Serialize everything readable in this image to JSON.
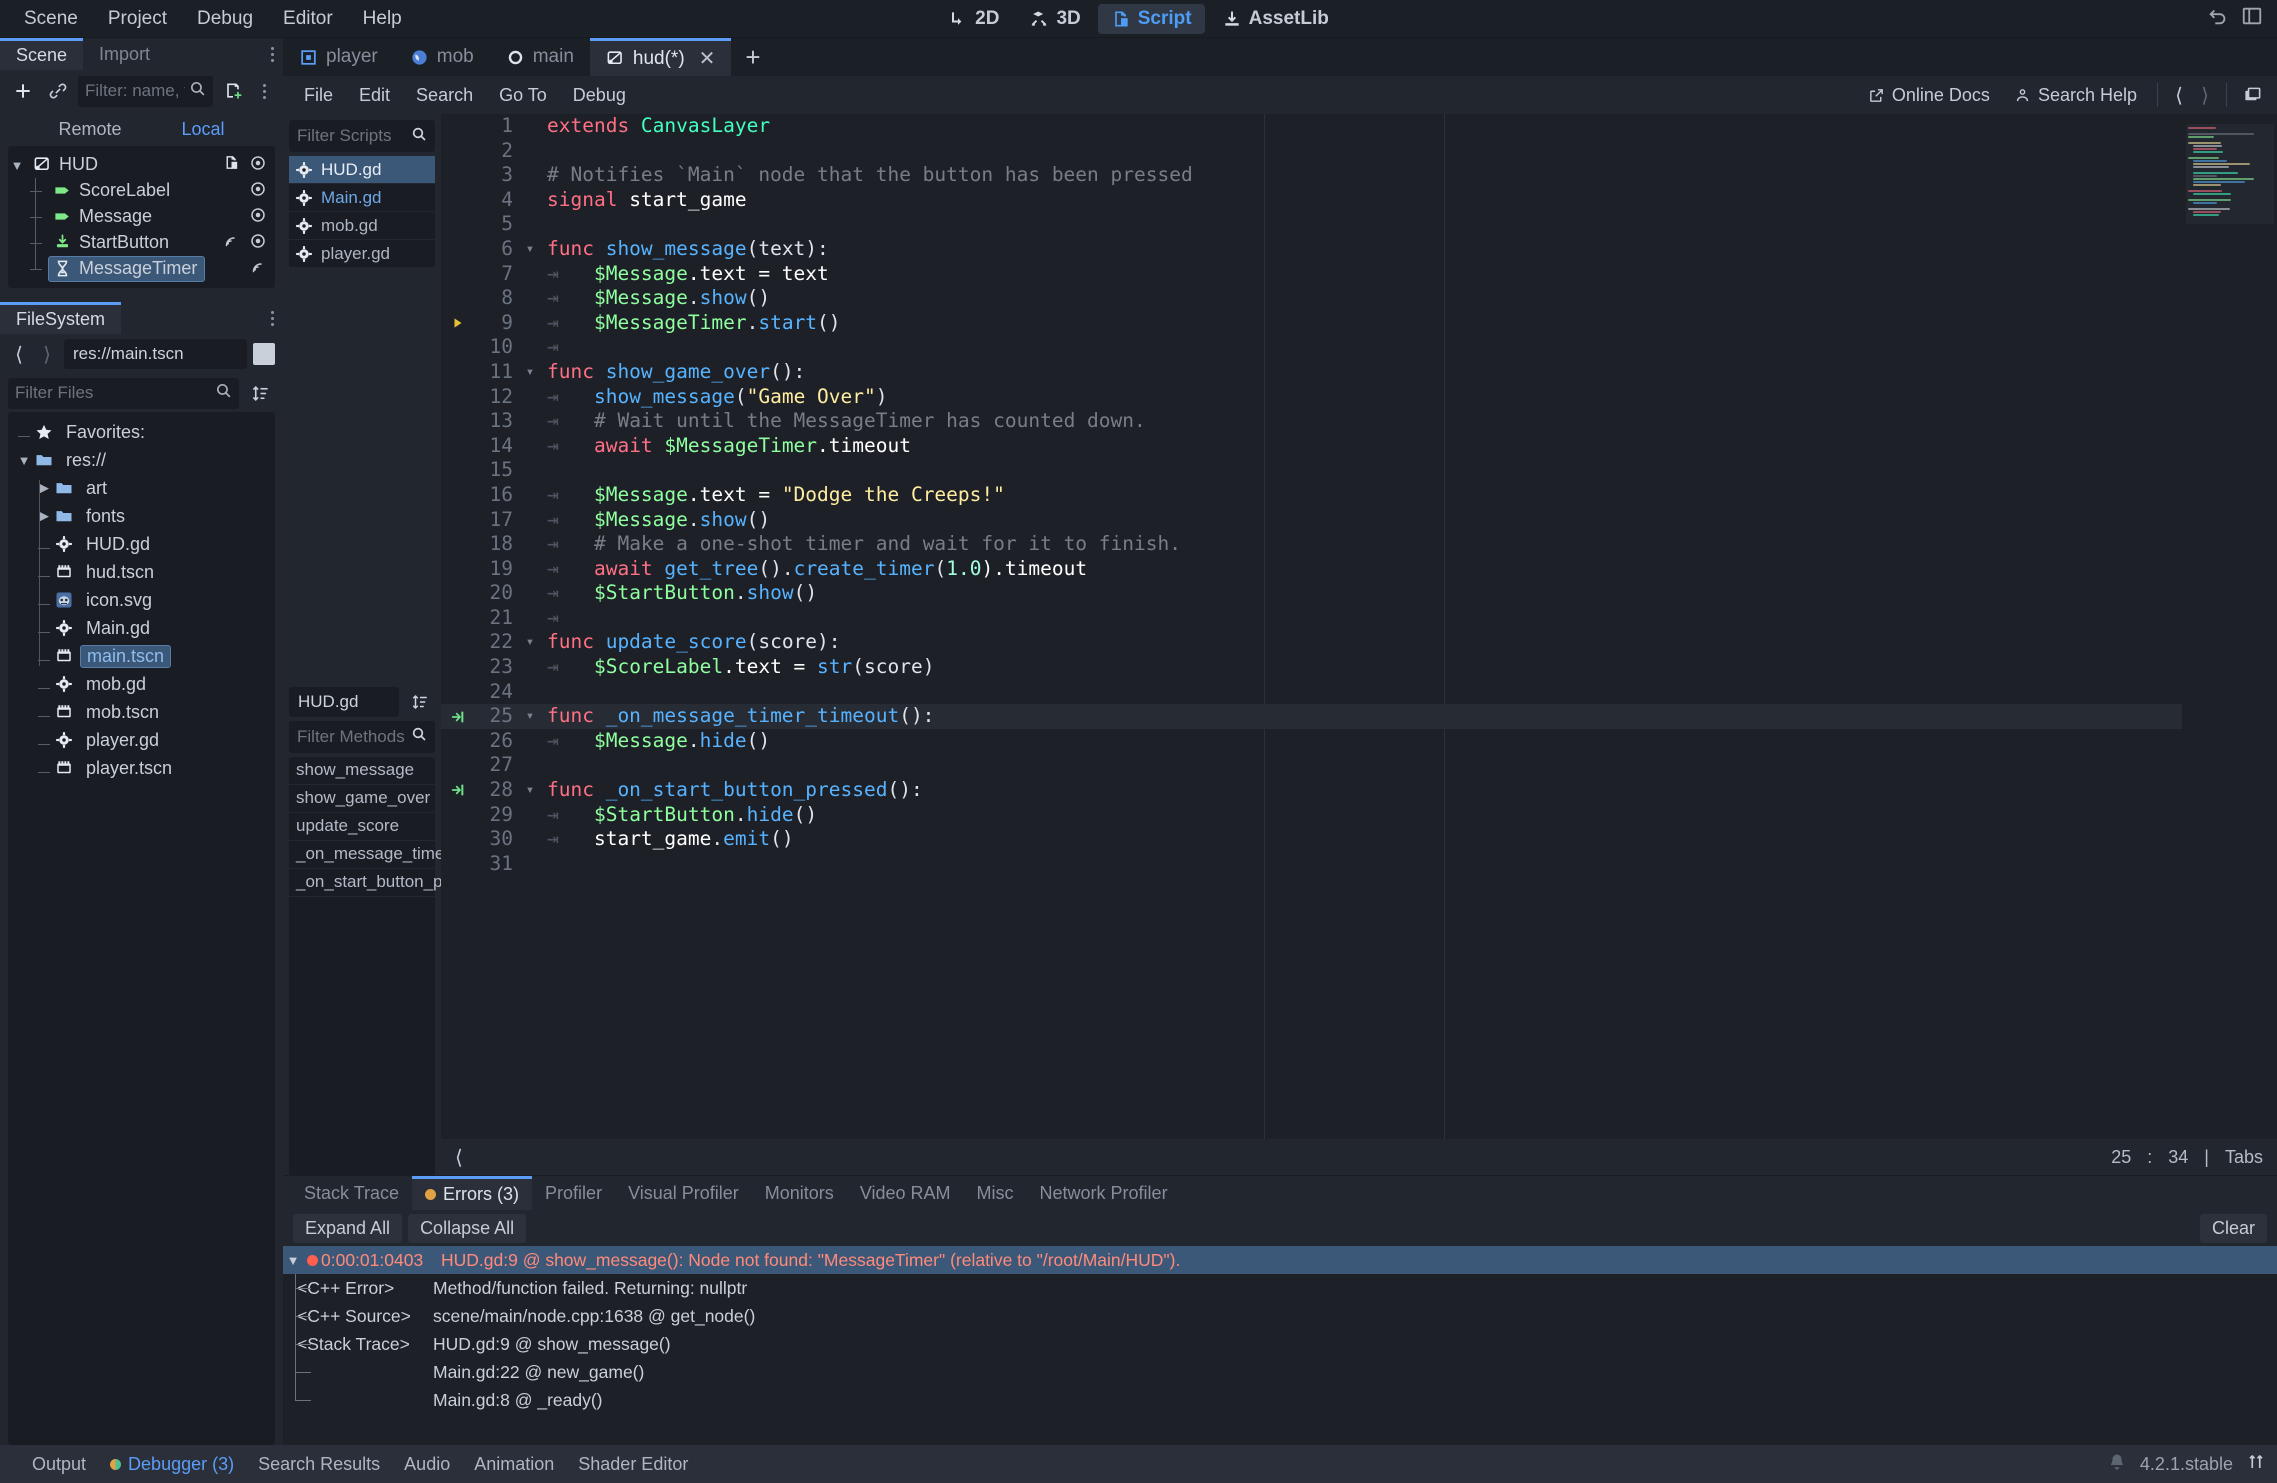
{
  "menubar": {
    "items": [
      "Scene",
      "Project",
      "Debug",
      "Editor",
      "Help"
    ]
  },
  "main_modes": [
    {
      "label": "2D",
      "icon": "2d-icon",
      "selected": false
    },
    {
      "label": "3D",
      "icon": "3d-icon",
      "selected": false
    },
    {
      "label": "Script",
      "icon": "script-icon",
      "selected": true
    },
    {
      "label": "AssetLib",
      "icon": "assetlib-icon",
      "selected": false
    }
  ],
  "topright": {
    "undo_icon": "undo-icon",
    "layout_icon": "layout-icon"
  },
  "scene_panel": {
    "tabs": [
      {
        "label": "Scene",
        "active": true
      },
      {
        "label": "Import",
        "active": false
      }
    ],
    "toolbar": {
      "add_icon": "add-node-icon",
      "link_icon": "instantiate-icon",
      "script_icon": "attach-script-icon",
      "menu_icon": "kebab-menu-icon"
    },
    "filter_placeholder": "Filter: name, t:t",
    "remote_label": "Remote",
    "local_label": "Local",
    "tree": [
      {
        "name": "HUD",
        "depth": 0,
        "icon": "canvaslayer-icon",
        "selected": false,
        "has_script": true,
        "has_signal": false,
        "visible_toggle": true
      },
      {
        "name": "ScoreLabel",
        "depth": 1,
        "icon": "label-icon",
        "selected": false,
        "has_script": false,
        "has_signal": false,
        "visible_toggle": true
      },
      {
        "name": "Message",
        "depth": 1,
        "icon": "label-icon",
        "selected": false,
        "has_script": false,
        "has_signal": false,
        "visible_toggle": true
      },
      {
        "name": "StartButton",
        "depth": 1,
        "icon": "button-icon",
        "selected": false,
        "has_script": false,
        "has_signal": true,
        "visible_toggle": true
      },
      {
        "name": "MessageTimer",
        "depth": 1,
        "icon": "timer-icon",
        "selected": true,
        "has_script": false,
        "has_signal": true,
        "visible_toggle": false
      }
    ]
  },
  "filesystem_panel": {
    "tab_label": "FileSystem",
    "path_value": "res://main.tscn",
    "filter_placeholder": "Filter Files",
    "back_icon": "chevron-left-icon",
    "forward_icon": "chevron-right-icon",
    "sort_icon": "sort-icon",
    "items": [
      {
        "name": "Favorites:",
        "depth": 0,
        "icon": "star-icon",
        "selected": false,
        "expand": ""
      },
      {
        "name": "res://",
        "depth": 0,
        "icon": "folder-icon",
        "selected": false,
        "expand": "v"
      },
      {
        "name": "art",
        "depth": 1,
        "icon": "folder-icon",
        "selected": false,
        "expand": ">"
      },
      {
        "name": "fonts",
        "depth": 1,
        "icon": "folder-icon",
        "selected": false,
        "expand": ">"
      },
      {
        "name": "HUD.gd",
        "depth": 1,
        "icon": "gdscript-icon",
        "selected": false,
        "expand": ""
      },
      {
        "name": "hud.tscn",
        "depth": 1,
        "icon": "scene-icon",
        "selected": false,
        "expand": ""
      },
      {
        "name": "icon.svg",
        "depth": 1,
        "icon": "svg-icon",
        "selected": false,
        "expand": ""
      },
      {
        "name": "Main.gd",
        "depth": 1,
        "icon": "gdscript-icon",
        "selected": false,
        "expand": ""
      },
      {
        "name": "main.tscn",
        "depth": 1,
        "icon": "scene-icon",
        "selected": true,
        "expand": ""
      },
      {
        "name": "mob.gd",
        "depth": 1,
        "icon": "gdscript-icon",
        "selected": false,
        "expand": ""
      },
      {
        "name": "mob.tscn",
        "depth": 1,
        "icon": "scene-icon",
        "selected": false,
        "expand": ""
      },
      {
        "name": "player.gd",
        "depth": 1,
        "icon": "gdscript-icon",
        "selected": false,
        "expand": ""
      },
      {
        "name": "player.tscn",
        "depth": 1,
        "icon": "scene-icon",
        "selected": false,
        "expand": ""
      }
    ]
  },
  "script_editor": {
    "tabs": [
      {
        "label": "player",
        "icon": "player-scene-icon",
        "active": false,
        "closable": false
      },
      {
        "label": "mob",
        "icon": "mob-scene-icon",
        "active": false,
        "closable": false
      },
      {
        "label": "main",
        "icon": "main-scene-icon",
        "active": false,
        "closable": false
      },
      {
        "label": "hud(*)",
        "icon": "hud-scene-icon",
        "active": true,
        "closable": true
      }
    ],
    "add_tab_icon": "plus-icon",
    "menu": [
      "File",
      "Edit",
      "Search",
      "Go To",
      "Debug"
    ],
    "online_docs": "Online Docs",
    "search_help": "Search Help",
    "nav_back_icon": "chevron-left-icon",
    "nav_forward_icon": "chevron-right-icon",
    "panel_icon": "panel-toggle-icon",
    "scripts_filter_placeholder": "Filter Scripts",
    "scripts": [
      {
        "name": "HUD.gd",
        "selected": true,
        "modified": false
      },
      {
        "name": "Main.gd",
        "selected": false,
        "modified": true
      },
      {
        "name": "mob.gd",
        "selected": false,
        "modified": false
      },
      {
        "name": "player.gd",
        "selected": false,
        "modified": false
      }
    ],
    "current_file": "HUD.gd",
    "methods_filter_placeholder": "Filter Methods",
    "methods": [
      "show_message",
      "show_game_over",
      "update_score",
      "_on_message_time...",
      "_on_start_button_p..."
    ],
    "status": {
      "line": "25",
      "colon": ":",
      "column": "34",
      "divider": "|",
      "indent_mode": "Tabs"
    },
    "hscroll_icon": "chevron-left-icon"
  },
  "code": {
    "lines": [
      {
        "n": "1",
        "fold": "",
        "marker": "",
        "indent": 0,
        "tokens": [
          {
            "t": "extends ",
            "c": "kw"
          },
          {
            "t": "CanvasLayer",
            "c": "type"
          }
        ]
      },
      {
        "n": "2",
        "fold": "",
        "marker": "",
        "indent": 0,
        "tokens": []
      },
      {
        "n": "3",
        "fold": "",
        "marker": "",
        "indent": 0,
        "tokens": [
          {
            "t": "# Notifies `Main` node that the button has been pressed",
            "c": "com"
          }
        ]
      },
      {
        "n": "4",
        "fold": "",
        "marker": "",
        "indent": 0,
        "tokens": [
          {
            "t": "signal ",
            "c": "kw"
          },
          {
            "t": "start_game",
            "c": "var"
          }
        ]
      },
      {
        "n": "5",
        "fold": "",
        "marker": "",
        "indent": 0,
        "tokens": []
      },
      {
        "n": "6",
        "fold": "v",
        "marker": "",
        "indent": 0,
        "tokens": [
          {
            "t": "func ",
            "c": "kw"
          },
          {
            "t": "show_message",
            "c": "fn"
          },
          {
            "t": "(text):",
            "c": "punc"
          }
        ]
      },
      {
        "n": "7",
        "fold": "",
        "marker": "",
        "indent": 1,
        "tokens": [
          {
            "t": "$Message",
            "c": "node"
          },
          {
            "t": ".text = text",
            "c": "mem"
          }
        ]
      },
      {
        "n": "8",
        "fold": "",
        "marker": "",
        "indent": 1,
        "tokens": [
          {
            "t": "$Message",
            "c": "node"
          },
          {
            "t": ".",
            "c": "punc"
          },
          {
            "t": "show",
            "c": "fn"
          },
          {
            "t": "()",
            "c": "punc"
          }
        ]
      },
      {
        "n": "9",
        "fold": "",
        "marker": "arrow",
        "indent": 1,
        "tokens": [
          {
            "t": "$MessageTimer",
            "c": "node"
          },
          {
            "t": ".",
            "c": "punc"
          },
          {
            "t": "start",
            "c": "fn"
          },
          {
            "t": "()",
            "c": "punc"
          }
        ]
      },
      {
        "n": "10",
        "fold": "",
        "marker": "",
        "indent": 1,
        "tokens": []
      },
      {
        "n": "11",
        "fold": "v",
        "marker": "",
        "indent": 0,
        "tokens": [
          {
            "t": "func ",
            "c": "kw"
          },
          {
            "t": "show_game_over",
            "c": "fn"
          },
          {
            "t": "():",
            "c": "punc"
          }
        ]
      },
      {
        "n": "12",
        "fold": "",
        "marker": "",
        "indent": 1,
        "tokens": [
          {
            "t": "show_message",
            "c": "fn"
          },
          {
            "t": "(",
            "c": "punc"
          },
          {
            "t": "\"Game Over\"",
            "c": "str"
          },
          {
            "t": ")",
            "c": "punc"
          }
        ]
      },
      {
        "n": "13",
        "fold": "",
        "marker": "",
        "indent": 1,
        "tokens": [
          {
            "t": "# Wait until the MessageTimer has counted down.",
            "c": "com"
          }
        ]
      },
      {
        "n": "14",
        "fold": "",
        "marker": "",
        "indent": 1,
        "tokens": [
          {
            "t": "await ",
            "c": "kw"
          },
          {
            "t": "$MessageTimer",
            "c": "node"
          },
          {
            "t": ".timeout",
            "c": "mem"
          }
        ]
      },
      {
        "n": "15",
        "fold": "",
        "marker": "",
        "indent": 0,
        "tokens": []
      },
      {
        "n": "16",
        "fold": "",
        "marker": "",
        "indent": 1,
        "tokens": [
          {
            "t": "$Message",
            "c": "node"
          },
          {
            "t": ".text = ",
            "c": "mem"
          },
          {
            "t": "\"Dodge the Creeps!\"",
            "c": "str"
          }
        ]
      },
      {
        "n": "17",
        "fold": "",
        "marker": "",
        "indent": 1,
        "tokens": [
          {
            "t": "$Message",
            "c": "node"
          },
          {
            "t": ".",
            "c": "punc"
          },
          {
            "t": "show",
            "c": "fn"
          },
          {
            "t": "()",
            "c": "punc"
          }
        ]
      },
      {
        "n": "18",
        "fold": "",
        "marker": "",
        "indent": 1,
        "tokens": [
          {
            "t": "# Make a one-shot timer and wait for it to finish.",
            "c": "com"
          }
        ]
      },
      {
        "n": "19",
        "fold": "",
        "marker": "",
        "indent": 1,
        "tokens": [
          {
            "t": "await ",
            "c": "kw"
          },
          {
            "t": "get_tree",
            "c": "fn"
          },
          {
            "t": "().",
            "c": "punc"
          },
          {
            "t": "create_timer",
            "c": "fn"
          },
          {
            "t": "(",
            "c": "punc"
          },
          {
            "t": "1.0",
            "c": "num"
          },
          {
            "t": ").timeout",
            "c": "mem"
          }
        ]
      },
      {
        "n": "20",
        "fold": "",
        "marker": "",
        "indent": 1,
        "tokens": [
          {
            "t": "$StartButton",
            "c": "node"
          },
          {
            "t": ".",
            "c": "punc"
          },
          {
            "t": "show",
            "c": "fn"
          },
          {
            "t": "()",
            "c": "punc"
          }
        ]
      },
      {
        "n": "21",
        "fold": "",
        "marker": "",
        "indent": 1,
        "tokens": []
      },
      {
        "n": "22",
        "fold": "v",
        "marker": "",
        "indent": 0,
        "tokens": [
          {
            "t": "func ",
            "c": "kw"
          },
          {
            "t": "update_score",
            "c": "fn"
          },
          {
            "t": "(score):",
            "c": "punc"
          }
        ]
      },
      {
        "n": "23",
        "fold": "",
        "marker": "",
        "indent": 1,
        "tokens": [
          {
            "t": "$ScoreLabel",
            "c": "node"
          },
          {
            "t": ".text = ",
            "c": "mem"
          },
          {
            "t": "str",
            "c": "fn"
          },
          {
            "t": "(score)",
            "c": "punc"
          }
        ]
      },
      {
        "n": "24",
        "fold": "",
        "marker": "",
        "indent": 0,
        "tokens": []
      },
      {
        "n": "25",
        "fold": "v",
        "marker": "connect",
        "indent": 0,
        "highlight": true,
        "tokens": [
          {
            "t": "func ",
            "c": "kw"
          },
          {
            "t": "_on_message_timer_timeout",
            "c": "fn"
          },
          {
            "t": "():",
            "c": "punc"
          }
        ]
      },
      {
        "n": "26",
        "fold": "",
        "marker": "",
        "indent": 1,
        "tokens": [
          {
            "t": "$Message",
            "c": "node"
          },
          {
            "t": ".",
            "c": "punc"
          },
          {
            "t": "hide",
            "c": "fn"
          },
          {
            "t": "()",
            "c": "punc"
          }
        ]
      },
      {
        "n": "27",
        "fold": "",
        "marker": "",
        "indent": 0,
        "tokens": []
      },
      {
        "n": "28",
        "fold": "v",
        "marker": "connect",
        "indent": 0,
        "tokens": [
          {
            "t": "func ",
            "c": "kw"
          },
          {
            "t": "_on_start_button_pressed",
            "c": "fn"
          },
          {
            "t": "():",
            "c": "punc"
          }
        ]
      },
      {
        "n": "29",
        "fold": "",
        "marker": "",
        "indent": 1,
        "tokens": [
          {
            "t": "$StartButton",
            "c": "node"
          },
          {
            "t": ".",
            "c": "punc"
          },
          {
            "t": "hide",
            "c": "fn"
          },
          {
            "t": "()",
            "c": "punc"
          }
        ]
      },
      {
        "n": "30",
        "fold": "",
        "marker": "",
        "indent": 1,
        "tokens": [
          {
            "t": "start_game",
            "c": "var"
          },
          {
            "t": ".",
            "c": "punc"
          },
          {
            "t": "emit",
            "c": "fn"
          },
          {
            "t": "()",
            "c": "punc"
          }
        ]
      },
      {
        "n": "31",
        "fold": "",
        "marker": "",
        "indent": 0,
        "tokens": []
      }
    ]
  },
  "debugger": {
    "tabs": [
      {
        "label": "Stack Trace",
        "active": false,
        "dot": false
      },
      {
        "label": "Errors (3)",
        "active": true,
        "dot": true
      },
      {
        "label": "Profiler",
        "active": false,
        "dot": false
      },
      {
        "label": "Visual Profiler",
        "active": false,
        "dot": false
      },
      {
        "label": "Monitors",
        "active": false,
        "dot": false
      },
      {
        "label": "Video RAM",
        "active": false,
        "dot": false
      },
      {
        "label": "Misc",
        "active": false,
        "dot": false
      },
      {
        "label": "Network Profiler",
        "active": false,
        "dot": false
      }
    ],
    "expand_all": "Expand All",
    "collapse_all": "Collapse All",
    "clear": "Clear",
    "rows": [
      {
        "kind": "error",
        "time": "0:00:01:0403",
        "label": "",
        "message": "HUD.gd:9 @ show_message(): Node not found: \"MessageTimer\" (relative to \"/root/Main/HUD\")."
      },
      {
        "kind": "child",
        "time": "",
        "label": "<C++ Error>",
        "message": "Method/function failed. Returning: nullptr"
      },
      {
        "kind": "child",
        "time": "",
        "label": "<C++ Source>",
        "message": "scene/main/node.cpp:1638 @ get_node()"
      },
      {
        "kind": "child",
        "time": "",
        "label": "<Stack Trace>",
        "message": "HUD.gd:9 @ show_message()"
      },
      {
        "kind": "child",
        "time": "",
        "label": "",
        "message": "Main.gd:22 @ new_game()"
      },
      {
        "kind": "child-last",
        "time": "",
        "label": "",
        "message": "Main.gd:8 @ _ready()"
      }
    ]
  },
  "statusbar": {
    "tabs": [
      {
        "label": "Output",
        "active": false,
        "dot": false
      },
      {
        "label": "Debugger (3)",
        "active": true,
        "dot": true
      },
      {
        "label": "Search Results",
        "active": false,
        "dot": false
      },
      {
        "label": "Audio",
        "active": false,
        "dot": false
      },
      {
        "label": "Animation",
        "active": false,
        "dot": false
      },
      {
        "label": "Shader Editor",
        "active": false,
        "dot": false
      }
    ],
    "version": "4.2.1.stable",
    "bell_icon": "bell-icon",
    "resize_icon": "resize-handle-icon"
  },
  "colors": {
    "accent": "#5b9df7",
    "error": "#ff8a7a",
    "selection": "#3c5878",
    "panel_bg": "#22262e",
    "editor_bg": "#1d2027"
  }
}
